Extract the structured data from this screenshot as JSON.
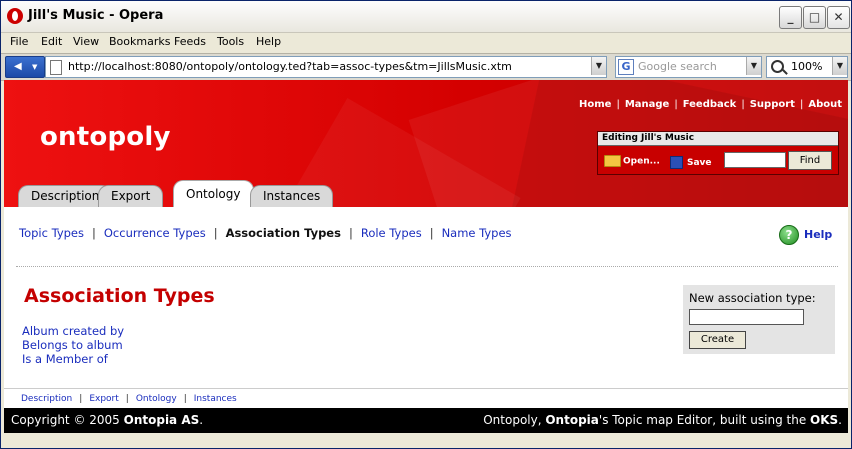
{
  "window": {
    "title": "Jill's Music - Opera",
    "controls": [
      "_",
      "□",
      "✕"
    ]
  },
  "menubar": [
    "File",
    "Edit",
    "View",
    "Bookmarks",
    "Feeds",
    "Tools",
    "Help"
  ],
  "address": {
    "url": "http://localhost:8080/ontopoly/ontology.ted?tab=assoc-types&tm=JillsMusic.xtm"
  },
  "search": {
    "placeholder": "Google search",
    "engine_glyph": "G"
  },
  "zoom": "100%",
  "site": {
    "brand": "ontopoly",
    "top_links": [
      "Home",
      "Manage",
      "Feedback",
      "Support",
      "About"
    ],
    "editing": {
      "header": "Editing Jill's Music",
      "open_label": "Open...",
      "save_label": "Save",
      "find_label": "Find"
    },
    "tabs": [
      "Description",
      "Export",
      "Ontology",
      "Instances"
    ],
    "subnav": [
      "Topic Types",
      "Occurrence Types",
      "Association Types",
      "Role Types",
      "Name Types"
    ],
    "help_label": "Help",
    "page_title": "Association Types",
    "association_types": [
      "Album created by",
      "Belongs to album",
      "Is a Member of"
    ],
    "new_type": {
      "label": "New association type:",
      "button": "Create"
    },
    "footer_nav": [
      "Description",
      "Export",
      "Ontology",
      "Instances"
    ],
    "footer": {
      "copyright_prefix": "Copyright © 2005 ",
      "company": "Ontopia AS",
      "copyright_suffix": ".",
      "r1": "Ontopoly, ",
      "r2": "Ontopia",
      "r3": "'s Topic map Editor, built using the ",
      "r4": "OKS",
      "r5": "."
    }
  },
  "colors": {
    "brand_red": "#d40000",
    "link_blue": "#1a2dbd",
    "title_red": "#c40000"
  }
}
